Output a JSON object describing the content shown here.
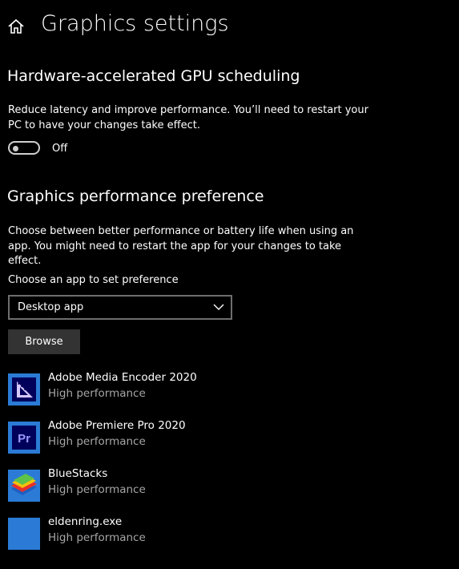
{
  "header": {
    "title": "Graphics settings",
    "home_icon": "home-icon"
  },
  "gpu_scheduling": {
    "title": "Hardware-accelerated GPU scheduling",
    "description": "Reduce latency and improve performance. You’ll need to restart your PC to have your changes take effect.",
    "toggle_state": "Off"
  },
  "performance_preference": {
    "title": "Graphics performance preference",
    "description": "Choose between better performance or battery life when using an app. You might need to restart the app for your changes to take effect.",
    "choose_label": "Choose an app to set preference",
    "dropdown_value": "Desktop app",
    "browse_label": "Browse"
  },
  "apps": [
    {
      "name": "Adobe Media Encoder 2020",
      "preference": "High performance",
      "icon": "media-encoder-icon"
    },
    {
      "name": "Adobe Premiere Pro 2020",
      "preference": "High performance",
      "icon": "premiere-pro-icon"
    },
    {
      "name": "BlueStacks",
      "preference": "High performance",
      "icon": "bluestacks-icon"
    },
    {
      "name": "eldenring.exe",
      "preference": "High performance",
      "icon": "generic-app-icon"
    }
  ],
  "colors": {
    "background": "#000000",
    "text": "#ffffff",
    "secondary_text": "#a6a6a6",
    "button": "#333333",
    "accent_blue": "#2b7bd6"
  }
}
